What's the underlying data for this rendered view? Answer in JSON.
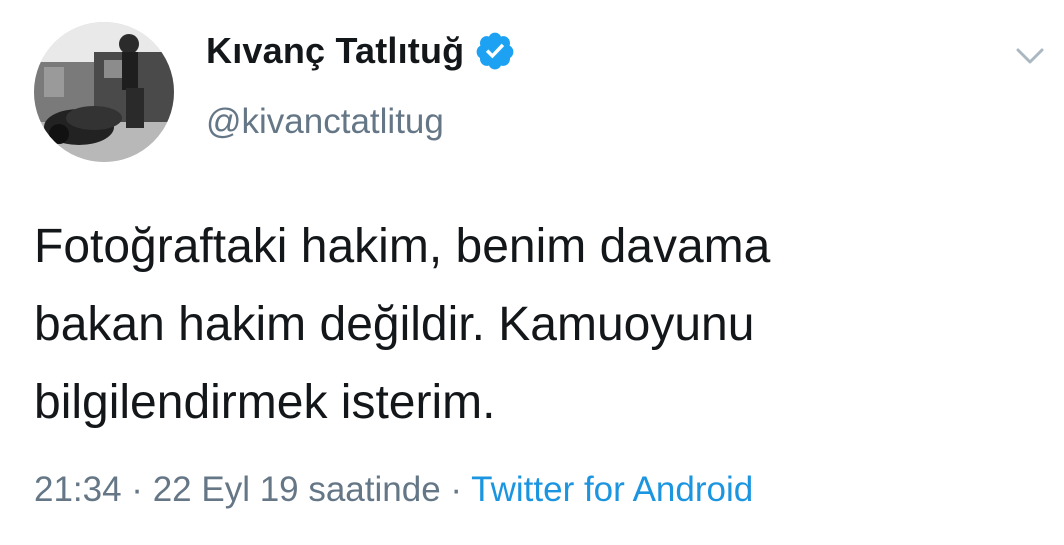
{
  "tweet": {
    "display_name": "Kıvanç Tatlıtuğ",
    "handle": "@kivanctatlitug",
    "verified": true,
    "text_lines": [
      "Fotoğraftaki hakim, benim davama",
      "bakan hakim değildir. Kamuoyunu",
      "bilgilendirmek isterim."
    ],
    "timestamp": "21:34 · 22 Eyl 19 saatinde",
    "separator": " · ",
    "source": "Twitter for Android"
  },
  "icons": {
    "verified": "verified-badge-icon",
    "menu": "chevron-down-icon"
  },
  "colors": {
    "text": "#14171a",
    "secondary": "#657786",
    "link": "#1b95e0",
    "verified": "#1da1f2"
  }
}
